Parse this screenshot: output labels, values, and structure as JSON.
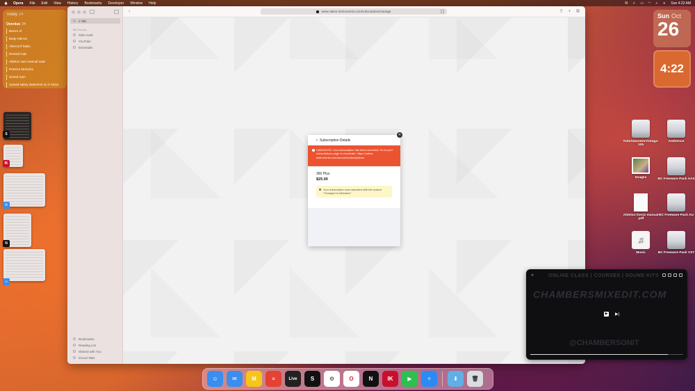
{
  "menubar": {
    "app_name": "Opera",
    "menus": [
      "File",
      "Edit",
      "View",
      "History",
      "Bookmarks",
      "Developer",
      "Window",
      "Help"
    ],
    "clock": "Sun 4:22 AM"
  },
  "reminders_widget": {
    "title": "Today",
    "today_count": "24",
    "overdue_label": "Overdue",
    "overdue_count": "24",
    "items": [
      "Basics of",
      "Body Haircut",
      "Afterconf Tasks",
      "Remind Cab",
      "Ableton user manual read",
      "Practice Melodics",
      "Sound Gym",
      "Upload salary statement on G Drive"
    ]
  },
  "browser": {
    "sidebar": {
      "tab_count": "1 Tab",
      "group_heading": "Tab Groups",
      "groups": [
        "Side Hustl",
        "YouTube",
        "Essentials"
      ],
      "bottom_items": [
        "Bookmarks",
        "Reading List",
        "Shared with You",
        "iCloud Tabs"
      ]
    },
    "url": "www.native-instruments.com/subscription/manage",
    "modal": {
      "back_label": "Subscription Details",
      "cancel_banner": "CANCELED: Your subscription has been canceled. Go to your subscriptions page to reactivate. https://native-instruments.com/account/subscriptions",
      "plan_name": "360 Plus",
      "plan_price": "$25.00",
      "notice": "Your subscription was canceled with the reason \"Changed to Melodics\""
    }
  },
  "widgets": {
    "calendar": {
      "weekday": "Sun",
      "month": "Oct",
      "day": "26"
    },
    "clock": {
      "time": "4:22"
    }
  },
  "desktop_icons": [
    {
      "label": "TubeSaturatorVintage-105",
      "kind": "drive"
    },
    {
      "label": "Ambience",
      "kind": "drive"
    },
    {
      "label": "Images",
      "kind": "images"
    },
    {
      "label": "BC Freeware Pack AAX",
      "kind": "drive"
    },
    {
      "label": "Ableton live12 manual .pdf",
      "kind": "doc"
    },
    {
      "label": "BC Freeware Pack AU",
      "kind": "drive"
    },
    {
      "label": "Music",
      "kind": "music"
    },
    {
      "label": "BC Freeware Pack VST",
      "kind": "drive"
    }
  ],
  "pip_video": {
    "header_text": "ONLINE CLASS | COURSES | SOUND KITS",
    "brand_text": "CHAMBERSMIXEDIT.COM",
    "handle_text": "@CHAMBERSONIT",
    "progress": 0.9
  },
  "dock_apps": [
    {
      "name": "finder-icon",
      "color": "#3a8ef0",
      "glyph": "☺"
    },
    {
      "name": "mail-icon",
      "color": "#3a8ef0",
      "glyph": "✉"
    },
    {
      "name": "miro-icon",
      "color": "#f5c518",
      "glyph": "M"
    },
    {
      "name": "todoist-icon",
      "color": "#e44232",
      "glyph": "≡"
    },
    {
      "name": "live-icon",
      "color": "#222222",
      "glyph": "Live"
    },
    {
      "name": "splice-icon",
      "color": "#111111",
      "glyph": "S"
    },
    {
      "name": "chatgpt-icon",
      "color": "#ffffff",
      "glyph": "⚙"
    },
    {
      "name": "opera-icon",
      "color": "#ffffff",
      "glyph": "O"
    },
    {
      "name": "native-access-icon",
      "color": "#111111",
      "glyph": "N"
    },
    {
      "name": "ik-product-manager-icon",
      "color": "#c8102e",
      "glyph": "IK"
    },
    {
      "name": "facetime-icon",
      "color": "#2fbf4f",
      "glyph": "▶"
    },
    {
      "name": "safari-icon",
      "color": "#2b8bf5",
      "glyph": "✧"
    },
    {
      "name": "downloads-folder-icon",
      "color": "#62aee6",
      "glyph": "⬇"
    },
    {
      "name": "trash-icon",
      "color": "#d9dce0",
      "glyph": "🗑"
    }
  ]
}
